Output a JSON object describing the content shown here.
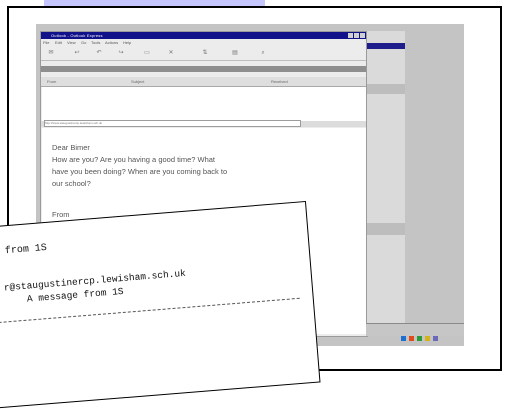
{
  "outlook": {
    "title": "Outlook - Outlook Express",
    "menu": [
      "File",
      "Edit",
      "View",
      "Go",
      "Tools",
      "Actions",
      "Help"
    ],
    "toolbar_icons": [
      "new-mail-icon",
      "reply-icon",
      "reply-all-icon",
      "forward-icon",
      "print-icon",
      "delete-icon",
      "send-receive-icon",
      "addresses-icon",
      "find-icon"
    ],
    "list_columns": [
      "From",
      "Subject",
      "Received"
    ],
    "address_bar": "http://www.staugustinercp.lewisham.sch.uk"
  },
  "message": {
    "greeting": "Dear Bimer",
    "body_lines": [
      "How are you? Are you having a good time? What",
      "have you been doing? When are you coming back to",
      "our school?"
    ],
    "sign_off": "From"
  },
  "printout": {
    "subject_fragment": "from 1S",
    "email_fragment": "r@staugustinercp.lewisham.sch.uk",
    "message_line": "A message from 1S"
  },
  "colors": {
    "tab": "#c6c6ff",
    "titlebar": "#11118a",
    "tray": [
      "#1d6fd0",
      "#e04a1c",
      "#2a9a3a",
      "#d6b21c",
      "#6a6ab8"
    ]
  }
}
